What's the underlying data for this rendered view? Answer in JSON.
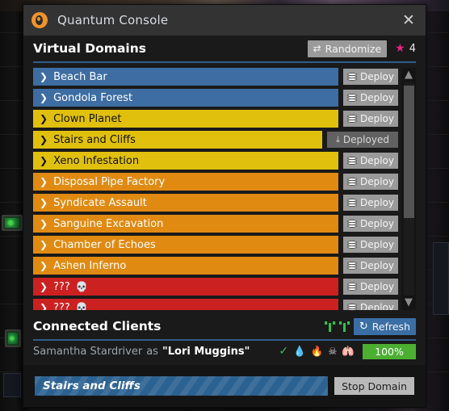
{
  "window": {
    "title": "Quantum Console",
    "icon": "eye-icon",
    "close_label": "✕"
  },
  "domains_section": {
    "title": "Virtual Domains",
    "randomize_label": "Randomize",
    "randomize_icon": "shuffle-icon",
    "star_icon": "star-icon",
    "star_count": "4",
    "star_color": "#e8257f",
    "scroll_up_icon": "chevron-up-icon",
    "scroll_down_icon": "chevron-down-icon",
    "rows": [
      {
        "name": "Beach Bar",
        "tier": "blue",
        "action": "Deploy",
        "deployed": false,
        "skull": ""
      },
      {
        "name": "Gondola Forest",
        "tier": "blue",
        "action": "Deploy",
        "deployed": false,
        "skull": ""
      },
      {
        "name": "Clown Planet",
        "tier": "yellow",
        "action": "Deploy",
        "deployed": false,
        "skull": ""
      },
      {
        "name": "Stairs and Cliffs",
        "tier": "yellow",
        "action": "Deployed",
        "deployed": true,
        "skull": ""
      },
      {
        "name": "Xeno Infestation",
        "tier": "yellow",
        "action": "Deploy",
        "deployed": false,
        "skull": ""
      },
      {
        "name": "Disposal Pipe Factory",
        "tier": "orange",
        "action": "Deploy",
        "deployed": false,
        "skull": ""
      },
      {
        "name": "Syndicate Assault",
        "tier": "orange",
        "action": "Deploy",
        "deployed": false,
        "skull": ""
      },
      {
        "name": "Sanguine Excavation",
        "tier": "orange",
        "action": "Deploy",
        "deployed": false,
        "skull": ""
      },
      {
        "name": "Chamber of Echoes",
        "tier": "orange",
        "action": "Deploy",
        "deployed": false,
        "skull": ""
      },
      {
        "name": "Ashen Inferno",
        "tier": "orange",
        "action": "Deploy",
        "deployed": false,
        "skull": ""
      },
      {
        "name": "???",
        "tier": "red",
        "action": "Deploy",
        "deployed": false,
        "skull": "💀"
      },
      {
        "name": "???",
        "tier": "red",
        "action": "Deploy",
        "deployed": false,
        "skull": "💀"
      }
    ]
  },
  "clients_section": {
    "title": "Connected Clients",
    "refresh_label": "Refresh",
    "refresh_icon": "refresh-icon",
    "signal_icon": "antenna-icon",
    "client": {
      "name": "Samantha Stardriver",
      "as_word": "as",
      "alias": "\"Lori Muggins\"",
      "status_check": "✓",
      "status_icons": [
        "water-drop-icon",
        "flame-icon",
        "bones-icon",
        "lungs-icon"
      ],
      "health": "100%",
      "health_color": "#4caf32"
    }
  },
  "footer": {
    "active_domain": "Stairs and Cliffs",
    "stop_label": "Stop Domain"
  }
}
